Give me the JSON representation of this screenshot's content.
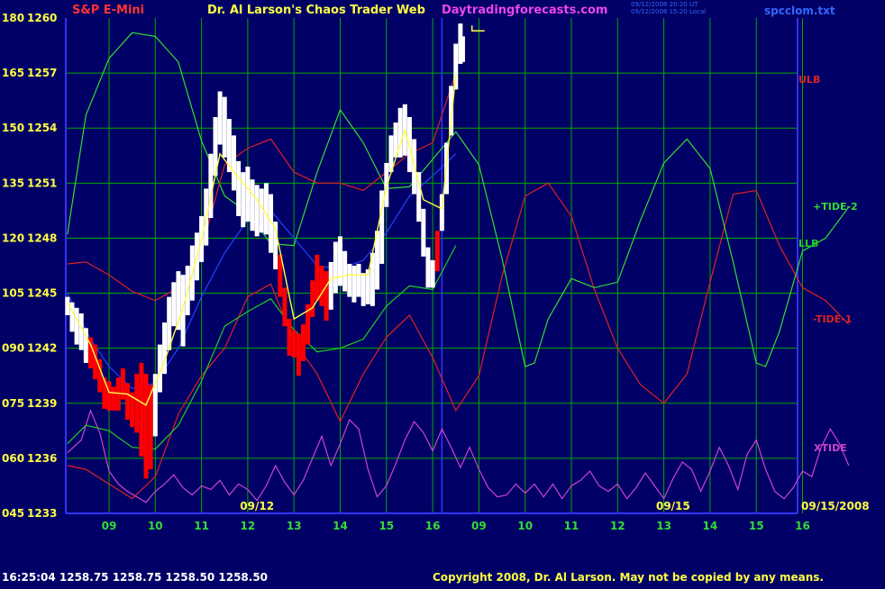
{
  "header": {
    "symbol": "S&P E-Mini",
    "title": "Dr. Al Larson's Chaos Trader Web",
    "site": "Daytradingforecasts.com",
    "timestamp_ut": "09/12/2008 20:20 UT",
    "timestamp_local": "09/12/2008 15:20 Local",
    "file": "spcclom.txt"
  },
  "footer": {
    "quote": "16:25:04  1258.75 1258.75 1258.50 1258.50",
    "copyright": "Copyright 2008, Dr. Al Larson. May not be copied by any means."
  },
  "colors": {
    "background": "#000066",
    "grid": "#00aa00",
    "axis": "#3333ff",
    "price_up": "#ffffff",
    "price_down": "#ff0000",
    "ulb": "#dd2222",
    "llb": "#22cc22",
    "tide_pos": "#33dd33",
    "tide_neg": "#dd2222",
    "xtide": "#cc44cc",
    "ma_yellow": "#ffff44",
    "ma_blue": "#2244ff"
  },
  "chart_data": {
    "type": "line",
    "y_left_labels": [
      "180",
      "165",
      "150",
      "135",
      "120",
      "105",
      "090",
      "075",
      "060",
      "045"
    ],
    "y_right_labels": [
      "1260",
      "1257",
      "1254",
      "1251",
      "1248",
      "1245",
      "1242",
      "1239",
      "1236",
      "1233"
    ],
    "ylim": [
      1233,
      1260
    ],
    "x_hours": [
      "09",
      "10",
      "11",
      "12",
      "13",
      "14",
      "15",
      "16",
      "09",
      "10",
      "11",
      "12",
      "13",
      "14",
      "15",
      "16"
    ],
    "date_labels": [
      {
        "text": "09/12",
        "at_hour": 3.2
      },
      {
        "text": "09/15",
        "at_hour": 12.2
      }
    ],
    "series_labels": {
      "ulb": "ULB",
      "llb": "LLB",
      "tide2": "+TIDE-2",
      "tide1": "-TIDE-1",
      "xtide": "XTIDE"
    },
    "end_date": "09/15/2008",
    "price_bars": [
      [
        -0.9,
        1244.8,
        1243.8,
        1
      ],
      [
        -0.8,
        1244.5,
        1242.9,
        1
      ],
      [
        -0.7,
        1244.2,
        1242.2,
        1
      ],
      [
        -0.6,
        1243.9,
        1241.9,
        1
      ],
      [
        -0.5,
        1243.1,
        1241.2,
        1
      ],
      [
        -0.4,
        1242.6,
        1240.9,
        0
      ],
      [
        -0.3,
        1242.2,
        1240.3,
        0
      ],
      [
        -0.2,
        1241.4,
        1239.6,
        0
      ],
      [
        -0.1,
        1240.4,
        1238.7,
        0
      ],
      [
        0.0,
        1240.2,
        1238.6,
        0
      ],
      [
        0.1,
        1239.9,
        1238.6,
        0
      ],
      [
        0.2,
        1240.4,
        1238.6,
        0
      ],
      [
        0.3,
        1240.9,
        1239.2,
        0
      ],
      [
        0.4,
        1240.1,
        1238.1,
        0
      ],
      [
        0.5,
        1239.6,
        1237.7,
        0
      ],
      [
        0.6,
        1240.6,
        1237.4,
        0
      ],
      [
        0.7,
        1241.2,
        1236.1,
        0
      ],
      [
        0.8,
        1240.6,
        1234.9,
        0
      ],
      [
        0.9,
        1240.0,
        1235.4,
        0
      ],
      [
        1.0,
        1240.6,
        1237.2,
        1
      ],
      [
        1.1,
        1242.2,
        1239.6,
        1
      ],
      [
        1.2,
        1243.4,
        1240.6,
        1
      ],
      [
        1.3,
        1244.8,
        1241.9,
        1
      ],
      [
        1.4,
        1245.6,
        1243.2,
        1
      ],
      [
        1.5,
        1246.2,
        1243.0,
        1
      ],
      [
        1.6,
        1246.0,
        1242.1,
        1
      ],
      [
        1.7,
        1246.5,
        1243.8,
        1
      ],
      [
        1.8,
        1247.6,
        1244.6,
        1
      ],
      [
        1.9,
        1248.3,
        1245.7,
        1
      ],
      [
        2.0,
        1249.2,
        1246.7,
        1
      ],
      [
        2.1,
        1250.7,
        1247.6,
        1
      ],
      [
        2.2,
        1252.6,
        1249.1,
        1
      ],
      [
        2.3,
        1254.6,
        1251.4,
        1
      ],
      [
        2.4,
        1256.0,
        1253.1,
        1
      ],
      [
        2.5,
        1255.7,
        1252.4,
        1
      ],
      [
        2.6,
        1254.5,
        1251.6,
        1
      ],
      [
        2.7,
        1253.6,
        1250.6,
        1
      ],
      [
        2.8,
        1252.2,
        1249.2,
        1
      ],
      [
        2.9,
        1251.6,
        1248.6,
        1
      ],
      [
        3.0,
        1251.9,
        1248.9,
        1
      ],
      [
        3.1,
        1251.2,
        1248.4,
        1
      ],
      [
        3.2,
        1250.9,
        1248.1,
        1
      ],
      [
        3.3,
        1250.7,
        1248.3,
        1
      ],
      [
        3.4,
        1251.0,
        1248.2,
        1
      ],
      [
        3.5,
        1250.4,
        1247.2,
        1
      ],
      [
        3.6,
        1248.9,
        1246.3,
        1
      ],
      [
        3.7,
        1247.1,
        1244.8,
        0
      ],
      [
        3.8,
        1245.3,
        1243.2,
        0
      ],
      [
        3.9,
        1243.6,
        1241.6,
        0
      ],
      [
        4.0,
        1243.0,
        1241.5,
        0
      ],
      [
        4.1,
        1242.8,
        1240.5,
        0
      ],
      [
        4.2,
        1243.3,
        1241.3,
        0
      ],
      [
        4.3,
        1244.4,
        1242.2,
        0
      ],
      [
        4.4,
        1245.7,
        1243.7,
        0
      ],
      [
        4.5,
        1247.1,
        1244.6,
        0
      ],
      [
        4.6,
        1246.5,
        1244.3,
        0
      ],
      [
        4.7,
        1246.2,
        1243.5,
        0
      ],
      [
        4.8,
        1246.7,
        1244.1,
        1
      ],
      [
        4.9,
        1247.8,
        1245.0,
        1
      ],
      [
        5.0,
        1248.1,
        1245.4,
        1
      ],
      [
        5.1,
        1247.3,
        1245.1,
        1
      ],
      [
        5.2,
        1246.6,
        1244.8,
        1
      ],
      [
        5.3,
        1246.5,
        1244.5,
        1
      ],
      [
        5.4,
        1246.6,
        1244.8,
        1
      ],
      [
        5.5,
        1246.1,
        1244.3,
        1
      ],
      [
        5.6,
        1246.3,
        1244.4,
        1
      ],
      [
        5.7,
        1247.2,
        1244.3,
        1
      ],
      [
        5.8,
        1248.4,
        1245.2,
        1
      ],
      [
        5.9,
        1250.6,
        1246.6,
        1
      ],
      [
        6.0,
        1252.1,
        1249.7,
        1
      ],
      [
        6.1,
        1253.6,
        1251.6,
        1
      ],
      [
        6.2,
        1254.3,
        1252.4,
        1
      ],
      [
        6.3,
        1255.1,
        1252.4,
        1
      ],
      [
        6.4,
        1255.3,
        1252.5,
        1
      ],
      [
        6.5,
        1254.6,
        1251.6,
        1
      ],
      [
        6.6,
        1253.4,
        1250.4,
        1
      ],
      [
        6.7,
        1251.6,
        1248.9,
        1
      ],
      [
        6.8,
        1249.6,
        1247.0,
        1
      ],
      [
        6.9,
        1247.5,
        1245.3,
        1
      ],
      [
        7.0,
        1246.8,
        1245.3,
        1
      ],
      [
        7.1,
        1248.4,
        1246.2,
        0
      ],
      [
        7.2,
        1250.4,
        1248.4,
        1
      ],
      [
        7.3,
        1253.2,
        1250.4,
        1
      ],
      [
        7.4,
        1256.3,
        1253.6,
        1
      ],
      [
        7.5,
        1258.6,
        1256.1,
        1
      ],
      [
        7.6,
        1259.7,
        1257.5,
        1
      ],
      [
        7.65,
        1259.0,
        1257.6,
        1
      ]
    ],
    "ma_yellow": [
      [
        -0.9,
        1244.5
      ],
      [
        -0.4,
        1242.2
      ],
      [
        0.0,
        1239.6
      ],
      [
        0.4,
        1239.5
      ],
      [
        0.8,
        1238.9
      ],
      [
        1.2,
        1241.3
      ],
      [
        1.6,
        1244.2
      ],
      [
        2.0,
        1247.9
      ],
      [
        2.4,
        1252.6
      ],
      [
        2.8,
        1251.3
      ],
      [
        3.2,
        1250.1
      ],
      [
        3.6,
        1248.5
      ],
      [
        4.0,
        1243.6
      ],
      [
        4.4,
        1244.2
      ],
      [
        4.8,
        1245.8
      ],
      [
        5.2,
        1246.0
      ],
      [
        5.6,
        1246.0
      ],
      [
        6.0,
        1250.8
      ],
      [
        6.4,
        1253.9
      ],
      [
        6.8,
        1250.1
      ],
      [
        7.2,
        1249.6
      ],
      [
        7.5,
        1256.9
      ]
    ],
    "ma_blue": [
      [
        -0.9,
        1245.0
      ],
      [
        -0.4,
        1242.5
      ],
      [
        0.0,
        1241.0
      ],
      [
        0.5,
        1239.8
      ],
      [
        1.0,
        1240.1
      ],
      [
        1.5,
        1242.0
      ],
      [
        2.0,
        1244.8
      ],
      [
        2.5,
        1247.2
      ],
      [
        3.0,
        1249.0
      ],
      [
        3.5,
        1249.5
      ],
      [
        4.0,
        1248.0
      ],
      [
        4.5,
        1246.5
      ],
      [
        5.0,
        1246.3
      ],
      [
        5.5,
        1246.8
      ],
      [
        6.0,
        1248.3
      ],
      [
        6.5,
        1250.3
      ],
      [
        7.0,
        1251.4
      ],
      [
        7.5,
        1252.6
      ]
    ],
    "ulb": [
      [
        -0.9,
        1246.6
      ],
      [
        -0.5,
        1246.7
      ],
      [
        0.0,
        1246.0
      ],
      [
        0.5,
        1245.1
      ],
      [
        1.0,
        1244.6
      ],
      [
        1.5,
        1245.3
      ],
      [
        2.0,
        1247.4
      ],
      [
        2.5,
        1252.0
      ],
      [
        3.0,
        1252.9
      ],
      [
        3.5,
        1253.4
      ],
      [
        4.0,
        1251.6
      ],
      [
        4.5,
        1251.0
      ],
      [
        5.0,
        1251.0
      ],
      [
        5.5,
        1250.6
      ],
      [
        6.0,
        1251.6
      ],
      [
        6.5,
        1252.6
      ],
      [
        7.0,
        1253.2
      ],
      [
        7.5,
        1257.0
      ]
    ],
    "llb": [
      [
        -0.9,
        1236.8
      ],
      [
        -0.5,
        1237.8
      ],
      [
        0.0,
        1237.5
      ],
      [
        0.5,
        1236.6
      ],
      [
        1.0,
        1236.5
      ],
      [
        1.5,
        1237.8
      ],
      [
        2.0,
        1240.2
      ],
      [
        2.5,
        1243.2
      ],
      [
        3.0,
        1244.0
      ],
      [
        3.5,
        1244.7
      ],
      [
        4.0,
        1243.0
      ],
      [
        4.5,
        1241.8
      ],
      [
        5.0,
        1242.0
      ],
      [
        5.5,
        1242.5
      ],
      [
        6.0,
        1244.3
      ],
      [
        6.5,
        1245.4
      ],
      [
        7.0,
        1245.2
      ],
      [
        7.5,
        1247.6
      ]
    ],
    "tide2": [
      [
        -0.9,
        1248.2
      ],
      [
        -0.5,
        1254.7
      ],
      [
        0.0,
        1257.8
      ],
      [
        0.5,
        1259.2
      ],
      [
        1.0,
        1259.0
      ],
      [
        1.5,
        1257.6
      ],
      [
        2.0,
        1253.3
      ],
      [
        2.5,
        1250.3
      ],
      [
        3.0,
        1249.4
      ],
      [
        3.5,
        1247.7
      ],
      [
        4.0,
        1247.6
      ],
      [
        4.5,
        1251.6
      ],
      [
        5.0,
        1255.0
      ],
      [
        5.5,
        1253.2
      ],
      [
        6.0,
        1250.7
      ],
      [
        6.5,
        1250.8
      ],
      [
        7.0,
        1252.3
      ],
      [
        7.5,
        1253.8
      ],
      [
        8.0,
        1252.0
      ],
      [
        8.5,
        1246.9
      ],
      [
        9.0,
        1241.0
      ],
      [
        9.2,
        1241.2
      ],
      [
        9.5,
        1243.6
      ],
      [
        10.0,
        1245.8
      ],
      [
        10.5,
        1245.3
      ],
      [
        11.0,
        1245.6
      ],
      [
        11.5,
        1249.0
      ],
      [
        12.0,
        1252.1
      ],
      [
        12.5,
        1253.4
      ],
      [
        13.0,
        1251.8
      ],
      [
        13.5,
        1246.7
      ],
      [
        14.0,
        1241.2
      ],
      [
        14.2,
        1241.0
      ],
      [
        14.5,
        1242.9
      ],
      [
        15.0,
        1247.3
      ],
      [
        15.5,
        1248.0
      ],
      [
        16.0,
        1249.7
      ]
    ],
    "tide1": [
      [
        -0.9,
        1235.6
      ],
      [
        -0.5,
        1235.4
      ],
      [
        0.0,
        1234.6
      ],
      [
        0.5,
        1233.8
      ],
      [
        1.0,
        1235.0
      ],
      [
        1.5,
        1238.4
      ],
      [
        2.0,
        1240.5
      ],
      [
        2.5,
        1242.0
      ],
      [
        3.0,
        1244.8
      ],
      [
        3.5,
        1245.5
      ],
      [
        4.0,
        1242.4
      ],
      [
        4.5,
        1240.6
      ],
      [
        5.0,
        1238.0
      ],
      [
        5.5,
        1240.6
      ],
      [
        6.0,
        1242.6
      ],
      [
        6.5,
        1243.8
      ],
      [
        7.0,
        1241.5
      ],
      [
        7.5,
        1238.6
      ],
      [
        8.0,
        1240.5
      ],
      [
        8.5,
        1245.9
      ],
      [
        9.0,
        1250.3
      ],
      [
        9.5,
        1251.0
      ],
      [
        10.0,
        1249.2
      ],
      [
        10.5,
        1245.2
      ],
      [
        11.0,
        1242.0
      ],
      [
        11.5,
        1240.0
      ],
      [
        12.0,
        1239.0
      ],
      [
        12.5,
        1240.6
      ],
      [
        13.0,
        1245.6
      ],
      [
        13.5,
        1250.4
      ],
      [
        14.0,
        1250.6
      ],
      [
        14.5,
        1247.6
      ],
      [
        15.0,
        1245.3
      ],
      [
        15.5,
        1244.6
      ],
      [
        16.0,
        1243.3
      ]
    ],
    "xtide": [
      [
        -0.9,
        1236.3
      ],
      [
        -0.6,
        1237.0
      ],
      [
        -0.4,
        1238.6
      ],
      [
        -0.2,
        1237.4
      ],
      [
        0.0,
        1235.3
      ],
      [
        0.2,
        1234.6
      ],
      [
        0.4,
        1234.2
      ],
      [
        0.6,
        1233.9
      ],
      [
        0.8,
        1233.6
      ],
      [
        1.0,
        1234.2
      ],
      [
        1.2,
        1234.6
      ],
      [
        1.4,
        1235.1
      ],
      [
        1.6,
        1234.4
      ],
      [
        1.8,
        1234.0
      ],
      [
        2.0,
        1234.5
      ],
      [
        2.2,
        1234.3
      ],
      [
        2.4,
        1234.8
      ],
      [
        2.6,
        1234.0
      ],
      [
        2.8,
        1234.6
      ],
      [
        3.0,
        1234.3
      ],
      [
        3.2,
        1233.7
      ],
      [
        3.4,
        1234.5
      ],
      [
        3.6,
        1235.6
      ],
      [
        3.8,
        1234.7
      ],
      [
        4.0,
        1234.0
      ],
      [
        4.2,
        1234.8
      ],
      [
        4.4,
        1236.0
      ],
      [
        4.6,
        1237.2
      ],
      [
        4.8,
        1235.6
      ],
      [
        5.0,
        1236.8
      ],
      [
        5.2,
        1238.1
      ],
      [
        5.4,
        1237.6
      ],
      [
        5.6,
        1235.4
      ],
      [
        5.8,
        1233.9
      ],
      [
        6.0,
        1234.5
      ],
      [
        6.2,
        1235.7
      ],
      [
        6.4,
        1237.0
      ],
      [
        6.6,
        1238.0
      ],
      [
        6.8,
        1237.4
      ],
      [
        7.0,
        1236.4
      ],
      [
        7.2,
        1237.6
      ],
      [
        7.4,
        1236.6
      ],
      [
        7.6,
        1235.5
      ],
      [
        7.8,
        1236.6
      ],
      [
        8.0,
        1235.4
      ],
      [
        8.2,
        1234.4
      ],
      [
        8.4,
        1233.9
      ],
      [
        8.6,
        1234.0
      ],
      [
        8.8,
        1234.6
      ],
      [
        9.0,
        1234.1
      ],
      [
        9.2,
        1234.6
      ],
      [
        9.4,
        1233.9
      ],
      [
        9.6,
        1234.6
      ],
      [
        9.8,
        1233.8
      ],
      [
        10.0,
        1234.5
      ],
      [
        10.2,
        1234.8
      ],
      [
        10.4,
        1235.3
      ],
      [
        10.6,
        1234.5
      ],
      [
        10.8,
        1234.2
      ],
      [
        11.0,
        1234.6
      ],
      [
        11.2,
        1233.8
      ],
      [
        11.4,
        1234.4
      ],
      [
        11.6,
        1235.2
      ],
      [
        11.8,
        1234.5
      ],
      [
        12.0,
        1233.8
      ],
      [
        12.2,
        1234.9
      ],
      [
        12.4,
        1235.8
      ],
      [
        12.6,
        1235.4
      ],
      [
        12.8,
        1234.2
      ],
      [
        13.0,
        1235.3
      ],
      [
        13.2,
        1236.6
      ],
      [
        13.4,
        1235.6
      ],
      [
        13.6,
        1234.3
      ],
      [
        13.8,
        1236.2
      ],
      [
        14.0,
        1237.0
      ],
      [
        14.2,
        1235.4
      ],
      [
        14.4,
        1234.2
      ],
      [
        14.6,
        1233.8
      ],
      [
        14.8,
        1234.4
      ],
      [
        15.0,
        1235.3
      ],
      [
        15.2,
        1235.0
      ],
      [
        15.4,
        1236.6
      ],
      [
        15.6,
        1237.6
      ],
      [
        15.8,
        1236.8
      ],
      [
        16.0,
        1235.6
      ]
    ]
  }
}
